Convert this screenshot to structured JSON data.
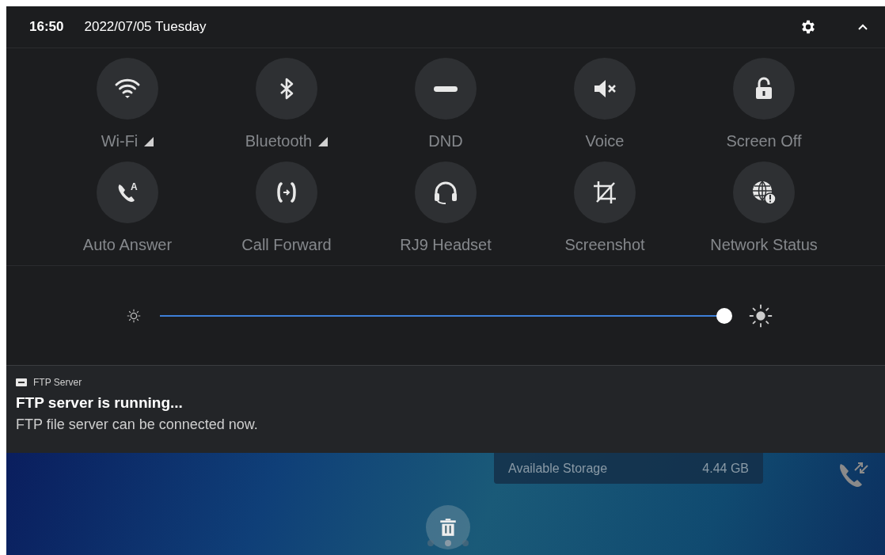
{
  "status_bar": {
    "time": "16:50",
    "date": "2022/07/05 Tuesday"
  },
  "quick_tiles": [
    {
      "label": "Wi-Fi",
      "has_menu": true
    },
    {
      "label": "Bluetooth",
      "has_menu": true
    },
    {
      "label": "DND",
      "has_menu": false
    },
    {
      "label": "Voice",
      "has_menu": false
    },
    {
      "label": "Screen Off",
      "has_menu": false
    },
    {
      "label": "Auto Answer",
      "has_menu": false,
      "icon_text": "A"
    },
    {
      "label": "Call Forward",
      "has_menu": false
    },
    {
      "label": "RJ9 Headset",
      "has_menu": false
    },
    {
      "label": "Screenshot",
      "has_menu": false
    },
    {
      "label": "Network Status",
      "has_menu": false
    }
  ],
  "brightness": {
    "level": 0.99
  },
  "notification": {
    "app": "FTP Server",
    "title": "FTP server is running...",
    "text": "FTP file server can be connected now."
  },
  "background": {
    "storage_label": "Available Storage",
    "storage_value": "4.44 GB",
    "pages": [
      {
        "selected": false
      },
      {
        "selected": true
      },
      {
        "selected": false
      }
    ]
  }
}
